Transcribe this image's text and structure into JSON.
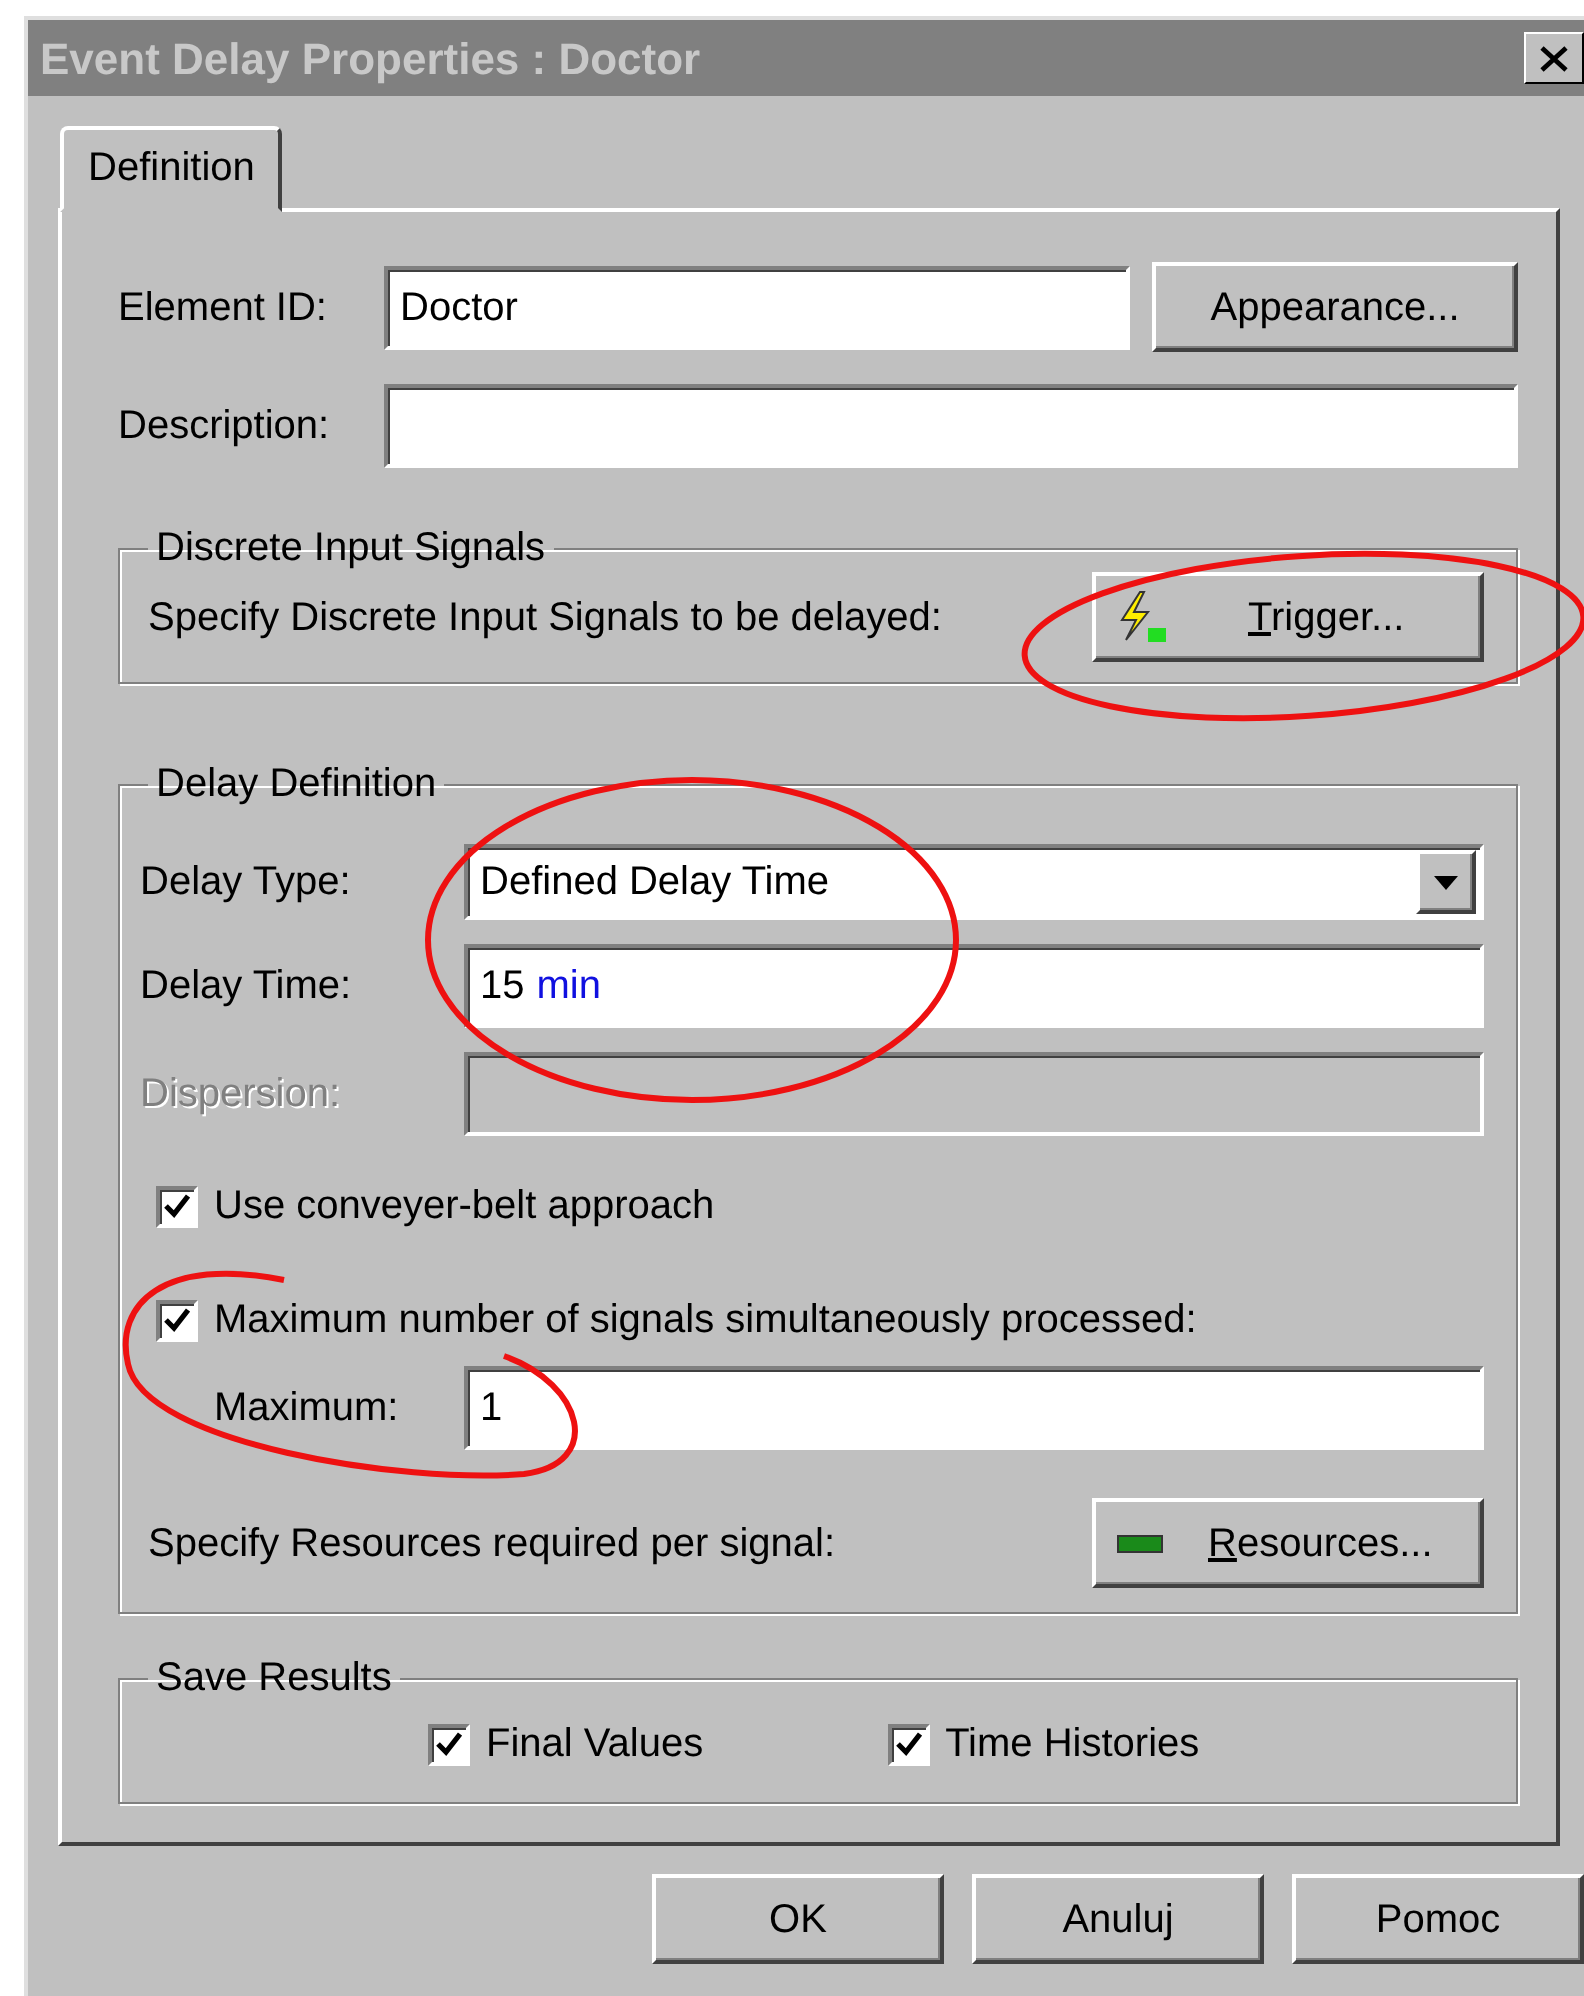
{
  "window": {
    "title": "Event Delay Properties : Doctor"
  },
  "tabs": [
    {
      "label": "Definition",
      "selected": true
    }
  ],
  "element_id": {
    "label": "Element ID:",
    "value": "Doctor"
  },
  "appearance_button": {
    "label": "Appearance...",
    "mnemonic": false
  },
  "description": {
    "label": "Description:"
  },
  "discrete_input_signals": {
    "title": "Discrete Input Signals",
    "text": "Specify Discrete Input Signals to be delayed:",
    "button": {
      "label": "Trigger...",
      "mnemonic": true
    }
  },
  "delay_definition": {
    "title": "Delay Definition",
    "fields": [
      {
        "kind": "select",
        "label": "Delay Type:",
        "value": "Defined Delay Time",
        "disabled": false
      },
      {
        "kind": "input",
        "label": "Delay Time:",
        "value": "15",
        "unit": "min",
        "disabled": false
      },
      {
        "kind": "input",
        "label": "Dispersion:",
        "disabled": true
      }
    ],
    "checkboxes": [
      {
        "label": "Use conveyer-belt approach",
        "checked": true
      },
      {
        "label": "Maximum number of signals simultaneously processed:",
        "checked": true
      }
    ],
    "maximum": {
      "label": "Maximum:",
      "value": "1"
    },
    "resources": {
      "text": "Specify Resources required per signal:",
      "button": {
        "label": "Resources...",
        "mnemonic": true
      }
    }
  },
  "save_results": {
    "title": "Save Results",
    "checkboxes": [
      {
        "label": "Final Values",
        "checked": true
      },
      {
        "label": "Time Histories",
        "checked": true
      }
    ]
  },
  "buttons": [
    {
      "label": "OK"
    },
    {
      "label": "Anuluj"
    },
    {
      "label": "Pomoc"
    }
  ],
  "annotations": [
    {
      "kind": "ellipse"
    },
    {
      "kind": "ellipse"
    },
    {
      "kind": "ellipse"
    }
  ]
}
